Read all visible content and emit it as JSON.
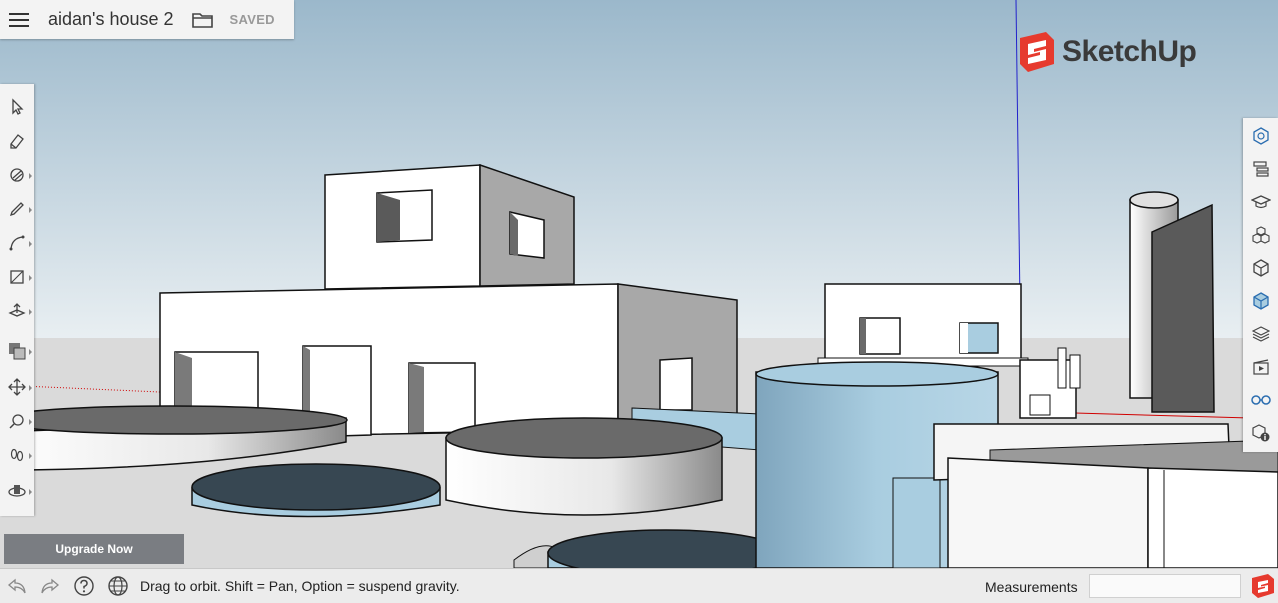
{
  "header": {
    "document_title": "aidan's house 2",
    "save_status": "SAVED"
  },
  "logo": {
    "text": "SketchUp"
  },
  "left_toolbar": {
    "tools": [
      {
        "icon": "select-arrow-icon",
        "has_submenu": false
      },
      {
        "icon": "eraser-icon",
        "has_submenu": false
      },
      {
        "icon": "paint-bucket-icon",
        "has_submenu": true
      },
      {
        "icon": "pencil-line-icon",
        "has_submenu": true
      },
      {
        "icon": "arc-icon",
        "has_submenu": true
      },
      {
        "icon": "rectangle-icon",
        "has_submenu": true
      },
      {
        "icon": "push-pull-icon",
        "has_submenu": true
      },
      {
        "icon": "offset-icon",
        "has_submenu": true
      },
      {
        "icon": "move-icon",
        "has_submenu": true
      },
      {
        "icon": "tape-measure-icon",
        "has_submenu": true
      },
      {
        "icon": "walk-footprints-icon",
        "has_submenu": true
      },
      {
        "icon": "orbit-icon",
        "has_submenu": true
      }
    ]
  },
  "right_toolbar": {
    "panels": [
      {
        "icon": "entity-info-icon"
      },
      {
        "icon": "outliner-icon"
      },
      {
        "icon": "instructor-icon"
      },
      {
        "icon": "components-icon"
      },
      {
        "icon": "materials-cube-icon"
      },
      {
        "icon": "styles-icon"
      },
      {
        "icon": "layers-icon"
      },
      {
        "icon": "scenes-icon"
      },
      {
        "icon": "display-glasses-icon"
      },
      {
        "icon": "model-info-icon"
      }
    ]
  },
  "upgrade": {
    "label": "Upgrade Now"
  },
  "statusbar": {
    "hint": "Drag to orbit. Shift = Pan, Option = suspend gravity.",
    "measurements_label": "Measurements",
    "measurements_value": ""
  },
  "colors": {
    "sky_top": "#9bb8cb",
    "ground": "#dadada",
    "accent_red": "#e63a2e",
    "face_blue": "#a9cde0",
    "axis_blue": "#2222cc",
    "axis_red": "#d00000"
  }
}
